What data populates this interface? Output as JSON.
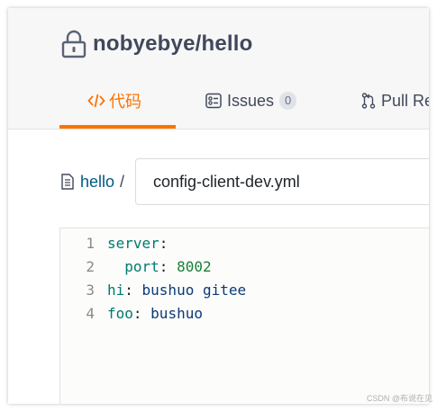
{
  "repo": {
    "name": "nobyebye/hello",
    "lock_icon": "lock-icon"
  },
  "tabs": [
    {
      "label": "代码",
      "icon": "code-icon",
      "active": true
    },
    {
      "label": "Issues",
      "icon": "issues-icon",
      "badge": "0"
    },
    {
      "label": "Pull Re",
      "icon": "pull-request-icon"
    }
  ],
  "breadcrumb": {
    "icon": "file-icon",
    "root": "hello",
    "separator": "/"
  },
  "filename_input": {
    "value": "config-client-dev.yml"
  },
  "code": {
    "lines": [
      {
        "num": "1",
        "indent": "",
        "key": "server",
        "colon": ":",
        "value": ""
      },
      {
        "num": "2",
        "indent": "  ",
        "key": "port",
        "colon": ": ",
        "value": "8002"
      },
      {
        "num": "3",
        "indent": "",
        "key": "hi",
        "colon": ": ",
        "value": "bushuo gitee"
      },
      {
        "num": "4",
        "indent": "",
        "key": "foo",
        "colon": ": ",
        "value": "bushuo"
      }
    ]
  },
  "watermark": "CSDN @布说在见",
  "colors": {
    "accent": "#fe7300",
    "link": "#005980",
    "header_bg": "#f7f7f7"
  }
}
